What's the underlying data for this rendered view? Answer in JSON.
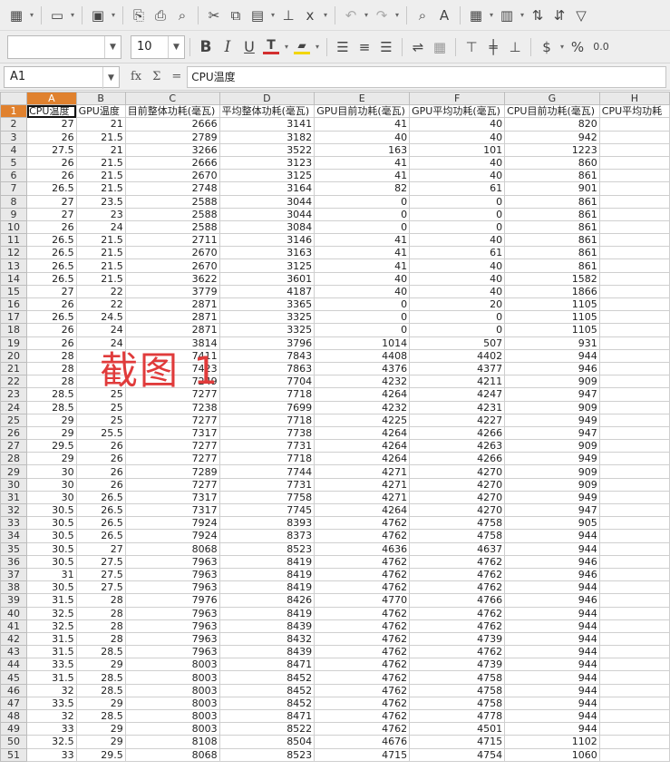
{
  "toolbar1": {
    "icons": [
      "table-icon",
      "folder-open-icon",
      "save-icon",
      "pdf-export-icon",
      "print-icon",
      "print-preview-icon",
      "cut-icon",
      "copy-icon",
      "paste-icon",
      "clone-formatting-icon",
      "clear-formatting-icon",
      "undo-icon",
      "redo-icon",
      "find-replace-icon",
      "spelling-icon",
      "row-icon",
      "column-icon",
      "sort-ascending-icon",
      "sort-descending-icon",
      "autofilter-icon"
    ]
  },
  "toolbar2": {
    "font_name": "",
    "font_size": "10",
    "bold": "B",
    "italic": "I",
    "underline": "U",
    "font_color_letter": "T",
    "colors": {
      "font": "#d32f2f",
      "highlight": "#f2d600",
      "active_header": "#e0812e",
      "overlay_text": "#e03b3b"
    },
    "currency": "$",
    "percent": "%",
    "number_format": "0.0"
  },
  "formula_bar": {
    "cell_ref": "A1",
    "fx": "fx",
    "sum": "Σ",
    "equals": "=",
    "content": "CPU温度"
  },
  "sheet": {
    "columns": [
      "A",
      "B",
      "C",
      "D",
      "E",
      "F",
      "G",
      "H"
    ],
    "active_column": "A",
    "active_row": "1",
    "headers": [
      "CPU温度",
      "GPU温度",
      "目前整体功耗(毫瓦)",
      "平均整体功耗(毫瓦)",
      "GPU目前功耗(毫瓦)",
      "GPU平均功耗(毫瓦)",
      "CPU目前功耗(毫瓦)",
      "CPU平均功耗"
    ],
    "rows": [
      {
        "n": "2",
        "c": [
          "27",
          "21",
          "2666",
          "3141",
          "41",
          "40",
          "820",
          ""
        ]
      },
      {
        "n": "3",
        "c": [
          "26",
          "21.5",
          "2789",
          "3182",
          "40",
          "40",
          "942",
          ""
        ]
      },
      {
        "n": "4",
        "c": [
          "27.5",
          "21",
          "3266",
          "3522",
          "163",
          "101",
          "1223",
          ""
        ]
      },
      {
        "n": "5",
        "c": [
          "26",
          "21.5",
          "2666",
          "3123",
          "41",
          "40",
          "860",
          ""
        ]
      },
      {
        "n": "6",
        "c": [
          "26",
          "21.5",
          "2670",
          "3125",
          "41",
          "40",
          "861",
          ""
        ]
      },
      {
        "n": "7",
        "c": [
          "26.5",
          "21.5",
          "2748",
          "3164",
          "82",
          "61",
          "901",
          ""
        ]
      },
      {
        "n": "8",
        "c": [
          "27",
          "23.5",
          "2588",
          "3044",
          "0",
          "0",
          "861",
          ""
        ]
      },
      {
        "n": "9",
        "c": [
          "27",
          "23",
          "2588",
          "3044",
          "0",
          "0",
          "861",
          ""
        ]
      },
      {
        "n": "10",
        "c": [
          "26",
          "24",
          "2588",
          "3084",
          "0",
          "0",
          "861",
          ""
        ]
      },
      {
        "n": "11",
        "c": [
          "26.5",
          "21.5",
          "2711",
          "3146",
          "41",
          "40",
          "861",
          ""
        ]
      },
      {
        "n": "12",
        "c": [
          "26.5",
          "21.5",
          "2670",
          "3163",
          "41",
          "61",
          "861",
          ""
        ]
      },
      {
        "n": "13",
        "c": [
          "26.5",
          "21.5",
          "2670",
          "3125",
          "41",
          "40",
          "861",
          ""
        ]
      },
      {
        "n": "14",
        "c": [
          "26.5",
          "21.5",
          "3622",
          "3601",
          "40",
          "40",
          "1582",
          ""
        ]
      },
      {
        "n": "15",
        "c": [
          "27",
          "22",
          "3779",
          "4187",
          "40",
          "40",
          "1866",
          ""
        ]
      },
      {
        "n": "16",
        "c": [
          "26",
          "22",
          "2871",
          "3365",
          "0",
          "20",
          "1105",
          ""
        ]
      },
      {
        "n": "17",
        "c": [
          "26.5",
          "24.5",
          "2871",
          "3325",
          "0",
          "0",
          "1105",
          ""
        ]
      },
      {
        "n": "18",
        "c": [
          "26",
          "24",
          "2871",
          "3325",
          "0",
          "0",
          "1105",
          ""
        ]
      },
      {
        "n": "19",
        "c": [
          "26",
          "24",
          "3814",
          "3796",
          "1014",
          "507",
          "931",
          ""
        ]
      },
      {
        "n": "20",
        "c": [
          "28",
          "",
          "7411",
          "7843",
          "4408",
          "4402",
          "944",
          ""
        ]
      },
      {
        "n": "21",
        "c": [
          "28",
          "",
          "7423",
          "7863",
          "4376",
          "4377",
          "946",
          ""
        ]
      },
      {
        "n": "22",
        "c": [
          "28",
          "",
          "7249",
          "7704",
          "4232",
          "4211",
          "909",
          ""
        ]
      },
      {
        "n": "23",
        "c": [
          "28.5",
          "25",
          "7277",
          "7718",
          "4264",
          "4247",
          "947",
          ""
        ]
      },
      {
        "n": "24",
        "c": [
          "28.5",
          "25",
          "7238",
          "7699",
          "4232",
          "4231",
          "909",
          ""
        ]
      },
      {
        "n": "25",
        "c": [
          "29",
          "25",
          "7277",
          "7718",
          "4225",
          "4227",
          "949",
          ""
        ]
      },
      {
        "n": "26",
        "c": [
          "29",
          "25.5",
          "7317",
          "7738",
          "4264",
          "4266",
          "947",
          ""
        ]
      },
      {
        "n": "27",
        "c": [
          "29.5",
          "26",
          "7277",
          "7731",
          "4264",
          "4263",
          "909",
          ""
        ]
      },
      {
        "n": "28",
        "c": [
          "29",
          "26",
          "7277",
          "7718",
          "4264",
          "4266",
          "949",
          ""
        ]
      },
      {
        "n": "29",
        "c": [
          "30",
          "26",
          "7289",
          "7744",
          "4271",
          "4270",
          "909",
          ""
        ]
      },
      {
        "n": "30",
        "c": [
          "30",
          "26",
          "7277",
          "7731",
          "4271",
          "4270",
          "909",
          ""
        ]
      },
      {
        "n": "31",
        "c": [
          "30",
          "26.5",
          "7317",
          "7758",
          "4271",
          "4270",
          "949",
          ""
        ]
      },
      {
        "n": "32",
        "c": [
          "30.5",
          "26.5",
          "7317",
          "7745",
          "4264",
          "4270",
          "947",
          ""
        ]
      },
      {
        "n": "33",
        "c": [
          "30.5",
          "26.5",
          "7924",
          "8393",
          "4762",
          "4758",
          "905",
          ""
        ]
      },
      {
        "n": "34",
        "c": [
          "30.5",
          "26.5",
          "7924",
          "8373",
          "4762",
          "4758",
          "944",
          ""
        ]
      },
      {
        "n": "35",
        "c": [
          "30.5",
          "27",
          "8068",
          "8523",
          "4636",
          "4637",
          "944",
          ""
        ]
      },
      {
        "n": "36",
        "c": [
          "30.5",
          "27.5",
          "7963",
          "8419",
          "4762",
          "4762",
          "946",
          ""
        ]
      },
      {
        "n": "37",
        "c": [
          "31",
          "27.5",
          "7963",
          "8419",
          "4762",
          "4762",
          "946",
          ""
        ]
      },
      {
        "n": "38",
        "c": [
          "30.5",
          "27.5",
          "7963",
          "8419",
          "4762",
          "4762",
          "944",
          ""
        ]
      },
      {
        "n": "39",
        "c": [
          "31.5",
          "28",
          "7976",
          "8426",
          "4770",
          "4766",
          "946",
          ""
        ]
      },
      {
        "n": "40",
        "c": [
          "32.5",
          "28",
          "7963",
          "8419",
          "4762",
          "4762",
          "944",
          ""
        ]
      },
      {
        "n": "41",
        "c": [
          "32.5",
          "28",
          "7963",
          "8439",
          "4762",
          "4762",
          "944",
          ""
        ]
      },
      {
        "n": "42",
        "c": [
          "31.5",
          "28",
          "7963",
          "8432",
          "4762",
          "4739",
          "944",
          ""
        ]
      },
      {
        "n": "43",
        "c": [
          "31.5",
          "28.5",
          "7963",
          "8439",
          "4762",
          "4762",
          "944",
          ""
        ]
      },
      {
        "n": "44",
        "c": [
          "33.5",
          "29",
          "8003",
          "8471",
          "4762",
          "4739",
          "944",
          ""
        ]
      },
      {
        "n": "45",
        "c": [
          "31.5",
          "28.5",
          "8003",
          "8452",
          "4762",
          "4758",
          "944",
          ""
        ]
      },
      {
        "n": "46",
        "c": [
          "32",
          "28.5",
          "8003",
          "8452",
          "4762",
          "4758",
          "944",
          ""
        ]
      },
      {
        "n": "47",
        "c": [
          "33.5",
          "29",
          "8003",
          "8452",
          "4762",
          "4758",
          "944",
          ""
        ]
      },
      {
        "n": "48",
        "c": [
          "32",
          "28.5",
          "8003",
          "8471",
          "4762",
          "4778",
          "944",
          ""
        ]
      },
      {
        "n": "49",
        "c": [
          "33",
          "29",
          "8003",
          "8522",
          "4762",
          "4501",
          "944",
          ""
        ]
      },
      {
        "n": "50",
        "c": [
          "32.5",
          "29",
          "8108",
          "8504",
          "4676",
          "4715",
          "1102",
          ""
        ]
      },
      {
        "n": "51",
        "c": [
          "33",
          "29.5",
          "8068",
          "8523",
          "4715",
          "4754",
          "1060",
          ""
        ]
      }
    ]
  },
  "overlay": {
    "text": "截图 1"
  }
}
